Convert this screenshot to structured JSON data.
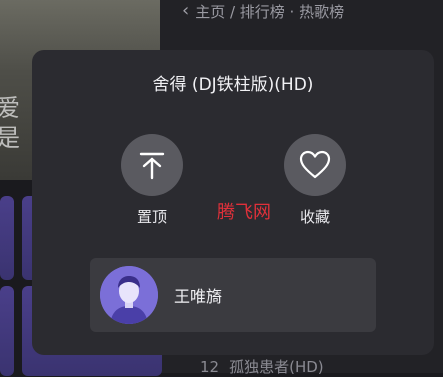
{
  "background": {
    "lyric_line_1": "爱",
    "lyric_line_2": "是",
    "breadcrumb": "主页 / 排行榜 · 热歌榜",
    "list_item": {
      "number": "12",
      "title": "孤独患者(HD)"
    }
  },
  "sheet": {
    "song_title": "舍得 (DJ铁柱版)(HD)",
    "actions": [
      {
        "label": "置顶",
        "icon": "pin-to-top-icon"
      },
      {
        "label": "收藏",
        "icon": "heart-icon"
      }
    ],
    "watermark": "腾飞网",
    "artist": {
      "name": "王唯旖",
      "icon": "avatar-icon"
    }
  },
  "colors": {
    "sheet_bg": "#2b2b30",
    "button_circle": "#5a5a60",
    "artist_card_bg": "#3b3b40",
    "avatar_bg": "#7b6fd8",
    "watermark": "#e0303a"
  }
}
